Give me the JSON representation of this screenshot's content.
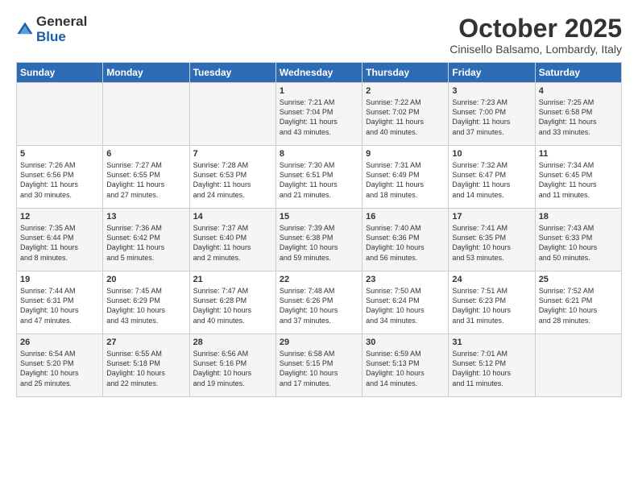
{
  "logo": {
    "general": "General",
    "blue": "Blue"
  },
  "header": {
    "month": "October 2025",
    "location": "Cinisello Balsamo, Lombardy, Italy"
  },
  "days_of_week": [
    "Sunday",
    "Monday",
    "Tuesday",
    "Wednesday",
    "Thursday",
    "Friday",
    "Saturday"
  ],
  "weeks": [
    [
      {
        "day": "",
        "info": ""
      },
      {
        "day": "",
        "info": ""
      },
      {
        "day": "",
        "info": ""
      },
      {
        "day": "1",
        "info": "Sunrise: 7:21 AM\nSunset: 7:04 PM\nDaylight: 11 hours\nand 43 minutes."
      },
      {
        "day": "2",
        "info": "Sunrise: 7:22 AM\nSunset: 7:02 PM\nDaylight: 11 hours\nand 40 minutes."
      },
      {
        "day": "3",
        "info": "Sunrise: 7:23 AM\nSunset: 7:00 PM\nDaylight: 11 hours\nand 37 minutes."
      },
      {
        "day": "4",
        "info": "Sunrise: 7:25 AM\nSunset: 6:58 PM\nDaylight: 11 hours\nand 33 minutes."
      }
    ],
    [
      {
        "day": "5",
        "info": "Sunrise: 7:26 AM\nSunset: 6:56 PM\nDaylight: 11 hours\nand 30 minutes."
      },
      {
        "day": "6",
        "info": "Sunrise: 7:27 AM\nSunset: 6:55 PM\nDaylight: 11 hours\nand 27 minutes."
      },
      {
        "day": "7",
        "info": "Sunrise: 7:28 AM\nSunset: 6:53 PM\nDaylight: 11 hours\nand 24 minutes."
      },
      {
        "day": "8",
        "info": "Sunrise: 7:30 AM\nSunset: 6:51 PM\nDaylight: 11 hours\nand 21 minutes."
      },
      {
        "day": "9",
        "info": "Sunrise: 7:31 AM\nSunset: 6:49 PM\nDaylight: 11 hours\nand 18 minutes."
      },
      {
        "day": "10",
        "info": "Sunrise: 7:32 AM\nSunset: 6:47 PM\nDaylight: 11 hours\nand 14 minutes."
      },
      {
        "day": "11",
        "info": "Sunrise: 7:34 AM\nSunset: 6:45 PM\nDaylight: 11 hours\nand 11 minutes."
      }
    ],
    [
      {
        "day": "12",
        "info": "Sunrise: 7:35 AM\nSunset: 6:44 PM\nDaylight: 11 hours\nand 8 minutes."
      },
      {
        "day": "13",
        "info": "Sunrise: 7:36 AM\nSunset: 6:42 PM\nDaylight: 11 hours\nand 5 minutes."
      },
      {
        "day": "14",
        "info": "Sunrise: 7:37 AM\nSunset: 6:40 PM\nDaylight: 11 hours\nand 2 minutes."
      },
      {
        "day": "15",
        "info": "Sunrise: 7:39 AM\nSunset: 6:38 PM\nDaylight: 10 hours\nand 59 minutes."
      },
      {
        "day": "16",
        "info": "Sunrise: 7:40 AM\nSunset: 6:36 PM\nDaylight: 10 hours\nand 56 minutes."
      },
      {
        "day": "17",
        "info": "Sunrise: 7:41 AM\nSunset: 6:35 PM\nDaylight: 10 hours\nand 53 minutes."
      },
      {
        "day": "18",
        "info": "Sunrise: 7:43 AM\nSunset: 6:33 PM\nDaylight: 10 hours\nand 50 minutes."
      }
    ],
    [
      {
        "day": "19",
        "info": "Sunrise: 7:44 AM\nSunset: 6:31 PM\nDaylight: 10 hours\nand 47 minutes."
      },
      {
        "day": "20",
        "info": "Sunrise: 7:45 AM\nSunset: 6:29 PM\nDaylight: 10 hours\nand 43 minutes."
      },
      {
        "day": "21",
        "info": "Sunrise: 7:47 AM\nSunset: 6:28 PM\nDaylight: 10 hours\nand 40 minutes."
      },
      {
        "day": "22",
        "info": "Sunrise: 7:48 AM\nSunset: 6:26 PM\nDaylight: 10 hours\nand 37 minutes."
      },
      {
        "day": "23",
        "info": "Sunrise: 7:50 AM\nSunset: 6:24 PM\nDaylight: 10 hours\nand 34 minutes."
      },
      {
        "day": "24",
        "info": "Sunrise: 7:51 AM\nSunset: 6:23 PM\nDaylight: 10 hours\nand 31 minutes."
      },
      {
        "day": "25",
        "info": "Sunrise: 7:52 AM\nSunset: 6:21 PM\nDaylight: 10 hours\nand 28 minutes."
      }
    ],
    [
      {
        "day": "26",
        "info": "Sunrise: 6:54 AM\nSunset: 5:20 PM\nDaylight: 10 hours\nand 25 minutes."
      },
      {
        "day": "27",
        "info": "Sunrise: 6:55 AM\nSunset: 5:18 PM\nDaylight: 10 hours\nand 22 minutes."
      },
      {
        "day": "28",
        "info": "Sunrise: 6:56 AM\nSunset: 5:16 PM\nDaylight: 10 hours\nand 19 minutes."
      },
      {
        "day": "29",
        "info": "Sunrise: 6:58 AM\nSunset: 5:15 PM\nDaylight: 10 hours\nand 17 minutes."
      },
      {
        "day": "30",
        "info": "Sunrise: 6:59 AM\nSunset: 5:13 PM\nDaylight: 10 hours\nand 14 minutes."
      },
      {
        "day": "31",
        "info": "Sunrise: 7:01 AM\nSunset: 5:12 PM\nDaylight: 10 hours\nand 11 minutes."
      },
      {
        "day": "",
        "info": ""
      }
    ]
  ]
}
